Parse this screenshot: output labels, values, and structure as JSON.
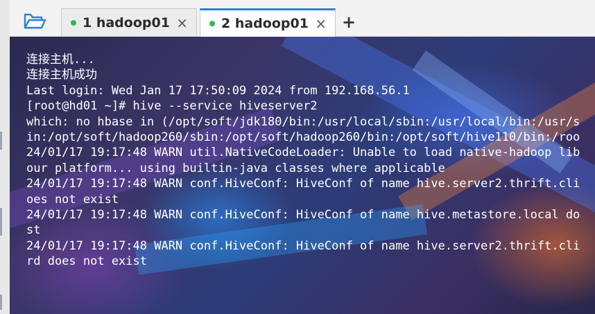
{
  "tabs": [
    {
      "label": "1 hadoop01",
      "close": "×",
      "active": false,
      "status_color": "#2db84d"
    },
    {
      "label": "2 hadoop01",
      "close": "×",
      "active": true,
      "status_color": "#2db84d"
    }
  ],
  "add_tab": "+",
  "icons": {
    "open_folder": "folder-open-icon"
  },
  "colors": {
    "accent": "#2f7fd6",
    "terminal_text": "#ffffff"
  },
  "terminal": {
    "lines": [
      "连接主机...",
      "连接主机成功",
      "Last login: Wed Jan 17 17:50:09 2024 from 192.168.56.1",
      "[root@hd01 ~]# hive --service hiveserver2",
      "which: no hbase in (/opt/soft/jdk180/bin:/usr/local/sbin:/usr/local/bin:/usr/s",
      "in:/opt/soft/hadoop260/sbin:/opt/soft/hadoop260/bin:/opt/soft/hive110/bin:/roo",
      "24/01/17 19:17:48 WARN util.NativeCodeLoader: Unable to load native-hadoop lib",
      "our platform... using builtin-java classes where applicable",
      "24/01/17 19:17:48 WARN conf.HiveConf: HiveConf of name hive.server2.thrift.cli",
      "oes not exist",
      "24/01/17 19:17:48 WARN conf.HiveConf: HiveConf of name hive.metastore.local do",
      "st",
      "24/01/17 19:17:48 WARN conf.HiveConf: HiveConf of name hive.server2.thrift.cli",
      "rd does not exist"
    ]
  }
}
